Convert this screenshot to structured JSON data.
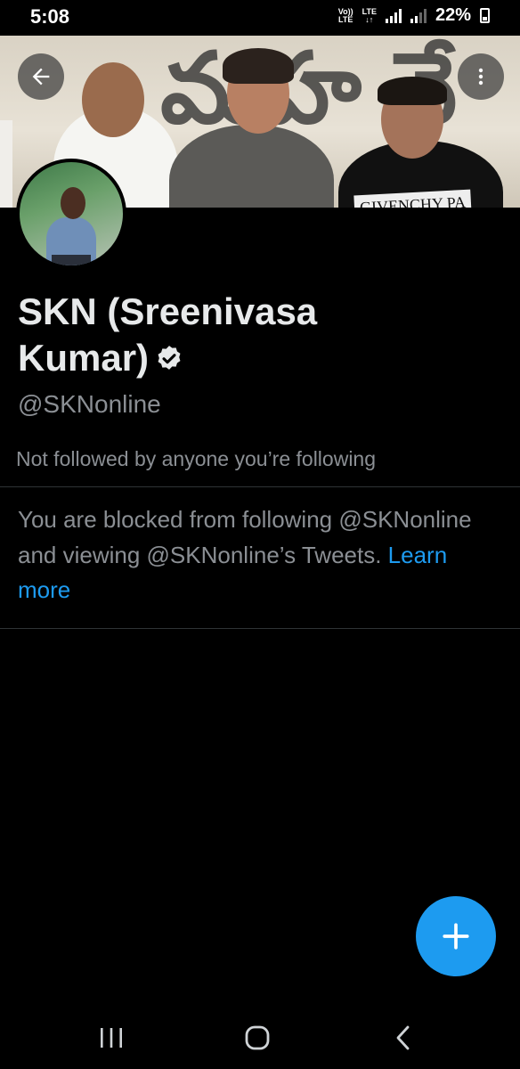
{
  "status_bar": {
    "time": "5:08",
    "network_badge": "Vo)) LTE",
    "lte_label": "LTE",
    "battery_percent": "22%",
    "icons": [
      "volte-icon",
      "signal-icon",
      "battery-charging-icon"
    ]
  },
  "header": {
    "back_icon": "arrow-left-icon",
    "more_icon": "vertical-dots-icon",
    "banner_visible_text": "GIVENCHY PA"
  },
  "profile": {
    "display_name": "SKN (Sreenivasa Kumar)",
    "handle": "@SKNonline",
    "verified": true,
    "followed_by_text": "Not followed by anyone you’re following"
  },
  "blocked_notice": {
    "text": "You are blocked from following @SKNonline and viewing @SKNonline’s Tweets.",
    "link_label": "Learn more"
  },
  "fab": {
    "icon": "plus-icon"
  },
  "nav_bar": {
    "icons": [
      "recent-apps-icon",
      "home-icon",
      "back-icon"
    ]
  },
  "colors": {
    "background": "#000000",
    "text_primary": "#e7e9ea",
    "text_secondary": "#8b8f94",
    "accent": "#1d9bf0",
    "divider": "#2f3336"
  }
}
